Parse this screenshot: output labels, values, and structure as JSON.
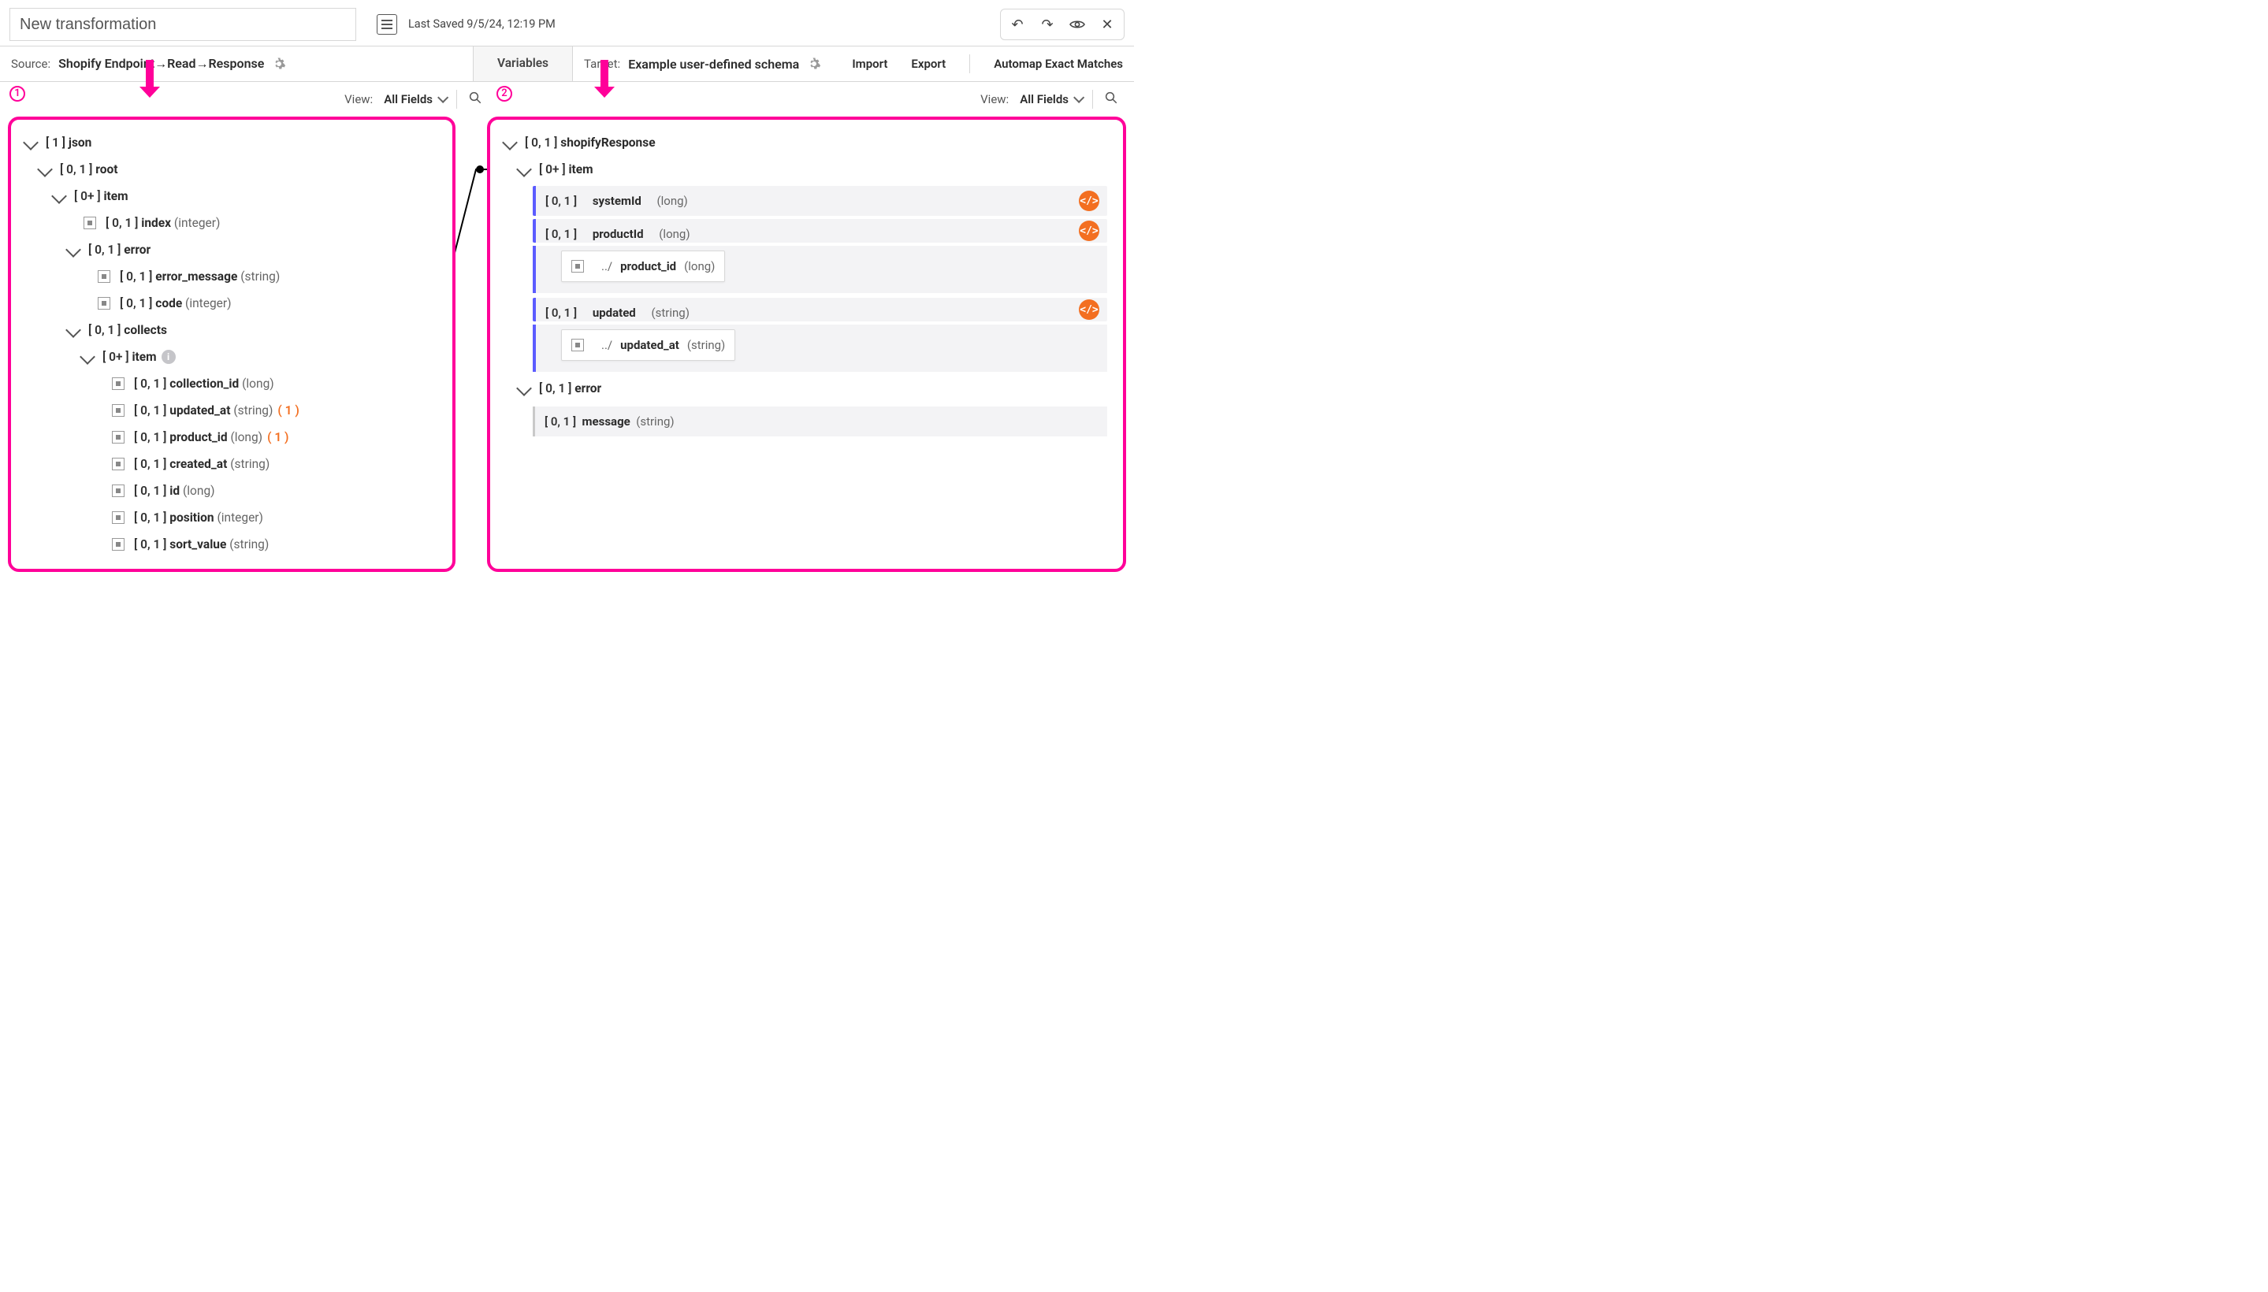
{
  "header": {
    "title_value": "New transformation",
    "last_saved": "Last Saved 9/5/24, 12:19 PM"
  },
  "subbar": {
    "source_label": "Source:",
    "source_value": "Shopify Endpoint→Read→Response",
    "variables_tab": "Variables",
    "target_label": "Target:",
    "target_value": "Example user-defined schema",
    "import": "Import",
    "export": "Export",
    "automap": "Automap Exact Matches"
  },
  "view": {
    "label": "View:",
    "all_fields": "All Fields"
  },
  "annotations": {
    "one": "1",
    "two": "2"
  },
  "source_tree": {
    "json": {
      "card": "[ 1 ]",
      "name": "json"
    },
    "root": {
      "card": "[ 0, 1 ]",
      "name": "root"
    },
    "item": {
      "card": "[ 0+ ]",
      "name": "item"
    },
    "index": {
      "card": "[ 0, 1 ]",
      "name": "index",
      "type": "(integer)"
    },
    "error": {
      "card": "[ 0, 1 ]",
      "name": "error"
    },
    "error_message": {
      "card": "[ 0, 1 ]",
      "name": "error_message",
      "type": "(string)"
    },
    "code": {
      "card": "[ 0, 1 ]",
      "name": "code",
      "type": "(integer)"
    },
    "collects": {
      "card": "[ 0, 1 ]",
      "name": "collects"
    },
    "c_item": {
      "card": "[ 0+ ]",
      "name": "item"
    },
    "collection_id": {
      "card": "[ 0, 1 ]",
      "name": "collection_id",
      "type": "(long)"
    },
    "updated_at": {
      "card": "[ 0, 1 ]",
      "name": "updated_at",
      "type": "(string)",
      "ref": "( 1 )"
    },
    "product_id": {
      "card": "[ 0, 1 ]",
      "name": "product_id",
      "type": "(long)",
      "ref": "( 1 )"
    },
    "created_at": {
      "card": "[ 0, 1 ]",
      "name": "created_at",
      "type": "(string)"
    },
    "id": {
      "card": "[ 0, 1 ]",
      "name": "id",
      "type": "(long)"
    },
    "position": {
      "card": "[ 0, 1 ]",
      "name": "position",
      "type": "(integer)"
    },
    "sort_value": {
      "card": "[ 0, 1 ]",
      "name": "sort_value",
      "type": "(string)"
    }
  },
  "target_tree": {
    "shopifyResponse": {
      "card": "[ 0, 1 ]",
      "name": "shopifyResponse"
    },
    "item": {
      "card": "[ 0+ ]",
      "name": "item"
    },
    "systemId": {
      "card": "[ 0, 1 ]",
      "name": "systemId",
      "type": "(long)"
    },
    "productId": {
      "card": "[ 0, 1 ]",
      "name": "productId",
      "type": "(long)"
    },
    "productId_src": {
      "path": "../",
      "name": "product_id",
      "type": "(long)"
    },
    "updated": {
      "card": "[ 0, 1 ]",
      "name": "updated",
      "type": "(string)"
    },
    "updated_src": {
      "path": "../",
      "name": "updated_at",
      "type": "(string)"
    },
    "error": {
      "card": "[ 0, 1 ]",
      "name": "error"
    },
    "message": {
      "card": "[ 0, 1 ]",
      "name": "message",
      "type": "(string)"
    },
    "code_badge": "</>"
  }
}
